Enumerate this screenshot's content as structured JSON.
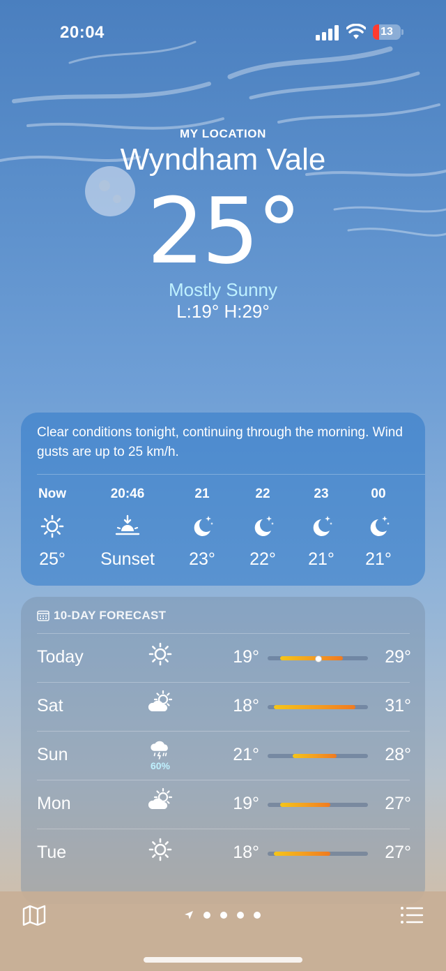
{
  "status_bar": {
    "time": "20:04",
    "battery_level": "13",
    "battery_fraction": 0.13,
    "battery_color": "#ff3b30"
  },
  "location": {
    "label": "MY LOCATION",
    "city": "Wyndham Vale"
  },
  "current": {
    "temperature": "25°",
    "condition": "Mostly Sunny",
    "hi_lo": "L:19° H:29°"
  },
  "hourly": {
    "summary": "Clear conditions tonight, continuing through the morning. Wind gusts are up to 25 km/h.",
    "items": [
      {
        "time": "Now",
        "icon": "sun-icon",
        "value": "25°"
      },
      {
        "time": "20:46",
        "icon": "sunset-icon",
        "value": "Sunset"
      },
      {
        "time": "21",
        "icon": "moon-stars-icon",
        "value": "23°"
      },
      {
        "time": "22",
        "icon": "moon-stars-icon",
        "value": "22°"
      },
      {
        "time": "23",
        "icon": "moon-stars-icon",
        "value": "21°"
      },
      {
        "time": "00",
        "icon": "moon-stars-icon",
        "value": "21°"
      }
    ]
  },
  "forecast": {
    "title": "10-DAY FORECAST",
    "icon": "calendar-icon",
    "scale_min": 17,
    "scale_max": 33,
    "days": [
      {
        "day": "Today",
        "icon": "sun-icon",
        "precip": "",
        "low": "19°",
        "high": "29°",
        "low_value": 19,
        "high_value": 29,
        "current_value": 25
      },
      {
        "day": "Sat",
        "icon": "partly-cloudy-icon",
        "precip": "",
        "low": "18°",
        "high": "31°",
        "low_value": 18,
        "high_value": 31
      },
      {
        "day": "Sun",
        "icon": "thunderstorm-rain-icon",
        "precip": "60%",
        "low": "21°",
        "high": "28°",
        "low_value": 21,
        "high_value": 28
      },
      {
        "day": "Mon",
        "icon": "partly-cloudy-icon",
        "precip": "",
        "low": "19°",
        "high": "27°",
        "low_value": 19,
        "high_value": 27
      },
      {
        "day": "Tue",
        "icon": "sun-icon",
        "precip": "",
        "low": "18°",
        "high": "27°",
        "low_value": 18,
        "high_value": 27
      }
    ]
  },
  "toolbar": {
    "map_icon": "map-icon",
    "location_icon": "location-arrow-icon",
    "list_icon": "list-icon",
    "page_count": 5
  }
}
